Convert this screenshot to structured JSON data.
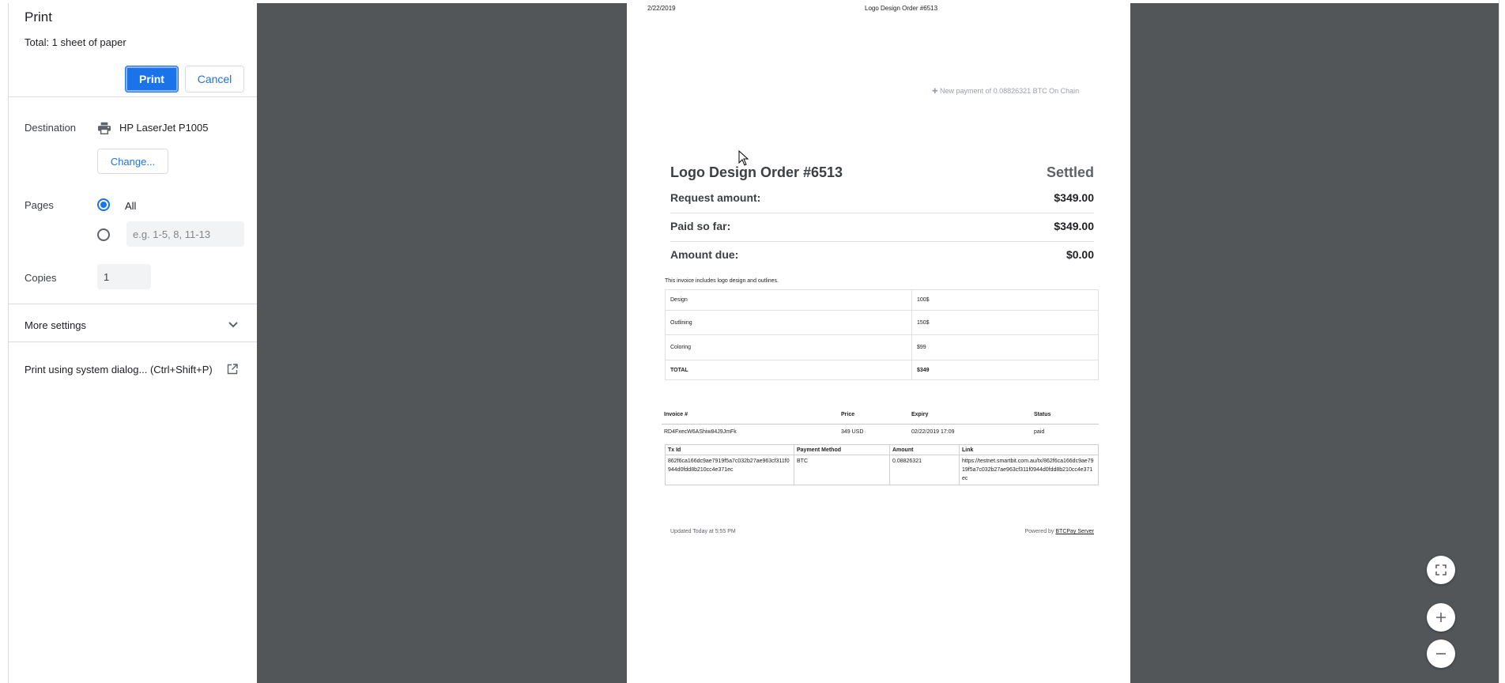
{
  "dialog": {
    "title": "Print",
    "total": "Total: 1 sheet of paper",
    "print_label": "Print",
    "cancel_label": "Cancel"
  },
  "destination": {
    "label": "Destination",
    "printer": "HP LaserJet P1005",
    "change_label": "Change..."
  },
  "pages": {
    "label": "Pages",
    "all_label": "All",
    "custom_placeholder": "e.g. 1-5, 8, 11-13"
  },
  "copies": {
    "label": "Copies",
    "value": "1"
  },
  "more_settings_label": "More settings",
  "system_dialog_label": "Print using system dialog... (Ctrl+Shift+P)",
  "document": {
    "header_date": "2/22/2019",
    "header_title": "Logo Design Order #6513",
    "new_payment": "✚ New payment of 0.08826321 BTC On Chain",
    "title": "Logo Design Order #6513",
    "status": "Settled",
    "amounts": [
      {
        "label": "Request amount:",
        "value": "$349.00"
      },
      {
        "label": "Paid so far:",
        "value": "$349.00"
      },
      {
        "label": "Amount due:",
        "value": "$0.00"
      }
    ],
    "description": "This invoice includes logo design and outlines.",
    "items": [
      {
        "name": "Design",
        "price": "100$"
      },
      {
        "name": "Outlining",
        "price": "150$"
      },
      {
        "name": "Coloring",
        "price": "$99"
      },
      {
        "name": "TOTAL",
        "price": "$349"
      }
    ],
    "invoice_headers": [
      "Invoice #",
      "Price",
      "Expiry",
      "Status"
    ],
    "invoice_row": {
      "id": "RD4FxecW6AShiw84J9JmFk",
      "price": "349 USD",
      "expiry": "02/22/2019 17:09",
      "status": "paid"
    },
    "tx_headers": [
      "Tx Id",
      "Payment Method",
      "Amount",
      "Link"
    ],
    "tx_row": {
      "tx_id": "862f6ca166dc9ae7919f5a7c032b27ae963cf311f0944d0fdd8b210cc4e371ec",
      "method": "BTC",
      "amount": "0.08826321",
      "link": "https://testnet.smartbit.com.au/tx/862f6ca166dc9ae7919f5a7c032b27ae963cf311f0944d0fdd8b210cc4e371ec"
    },
    "updated": "Updated Today at 5:55 PM",
    "powered_prefix": "Powered by",
    "powered_link": "BTCPay Server"
  },
  "icons": {
    "printer": "printer-icon",
    "chevron": "chevron-down-icon",
    "external": "open-in-new-icon",
    "fit": "fit-to-page-icon",
    "zoom_in": "zoom-in-icon",
    "zoom_out": "zoom-out-icon"
  },
  "colors": {
    "accent": "#1a73e8",
    "preview_bg": "#525659"
  }
}
